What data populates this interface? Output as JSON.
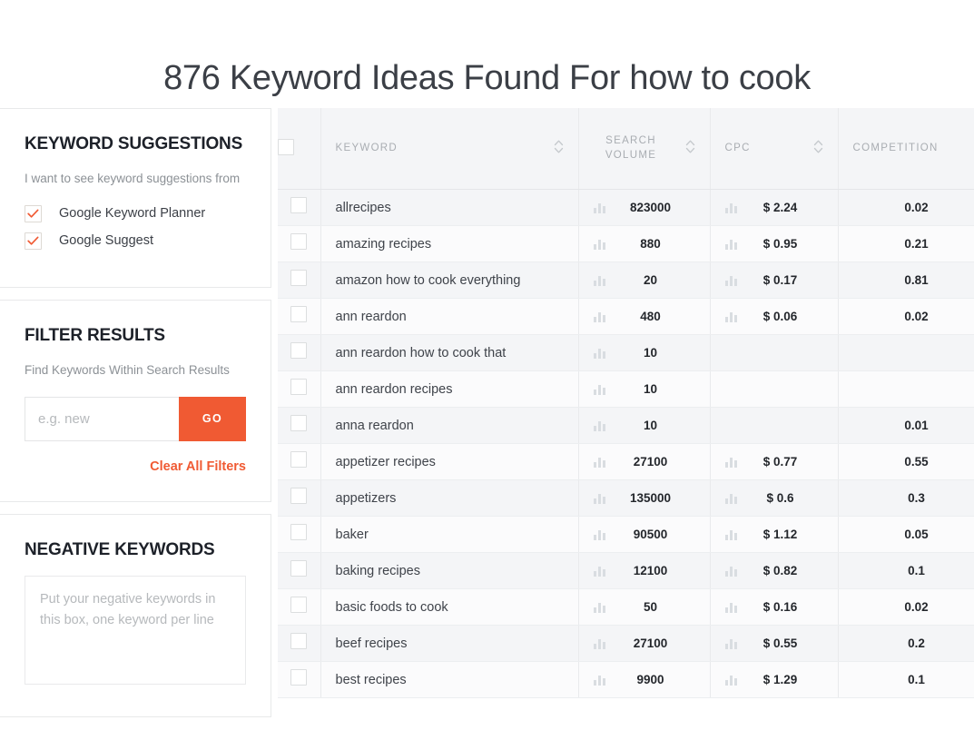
{
  "page": {
    "title": "876 Keyword Ideas Found For how to cook"
  },
  "sidebar": {
    "keyword_suggestions": {
      "title": "KEYWORD SUGGESTIONS",
      "subtitle": "I want to see keyword suggestions from",
      "options": [
        {
          "label": "Google Keyword Planner",
          "checked": true
        },
        {
          "label": "Google Suggest",
          "checked": true
        }
      ]
    },
    "filter_results": {
      "title": "FILTER RESULTS",
      "subtitle": "Find Keywords Within Search Results",
      "input_value": "",
      "input_placeholder": "e.g. new",
      "go_label": "GO",
      "clear_label": "Clear All Filters"
    },
    "negative_keywords": {
      "title": "NEGATIVE KEYWORDS",
      "textarea_value": "",
      "textarea_placeholder": "Put your negative keywords in this box, one keyword per line"
    }
  },
  "table": {
    "columns": [
      {
        "key": "checkbox",
        "label": "",
        "sortable": false
      },
      {
        "key": "keyword",
        "label": "KEYWORD",
        "sortable": true
      },
      {
        "key": "search_volume",
        "label": "SEARCH VOLUME",
        "sortable": true
      },
      {
        "key": "cpc",
        "label": "CPC",
        "sortable": true
      },
      {
        "key": "competition",
        "label": "COMPETITION",
        "sortable": false
      }
    ],
    "rows": [
      {
        "keyword": "allrecipes",
        "search_volume": "823000",
        "cpc": "$ 2.24",
        "competition": "0.02"
      },
      {
        "keyword": "amazing recipes",
        "search_volume": "880",
        "cpc": "$ 0.95",
        "competition": "0.21"
      },
      {
        "keyword": "amazon how to cook everything",
        "search_volume": "20",
        "cpc": "$ 0.17",
        "competition": "0.81"
      },
      {
        "keyword": "ann reardon",
        "search_volume": "480",
        "cpc": "$ 0.06",
        "competition": "0.02"
      },
      {
        "keyword": "ann reardon how to cook that",
        "search_volume": "10",
        "cpc": "",
        "competition": ""
      },
      {
        "keyword": "ann reardon recipes",
        "search_volume": "10",
        "cpc": "",
        "competition": ""
      },
      {
        "keyword": "anna reardon",
        "search_volume": "10",
        "cpc": "",
        "competition": "0.01"
      },
      {
        "keyword": "appetizer recipes",
        "search_volume": "27100",
        "cpc": "$ 0.77",
        "competition": "0.55"
      },
      {
        "keyword": "appetizers",
        "search_volume": "135000",
        "cpc": "$ 0.6",
        "competition": "0.3"
      },
      {
        "keyword": "baker",
        "search_volume": "90500",
        "cpc": "$ 1.12",
        "competition": "0.05"
      },
      {
        "keyword": "baking recipes",
        "search_volume": "12100",
        "cpc": "$ 0.82",
        "competition": "0.1"
      },
      {
        "keyword": "basic foods to cook",
        "search_volume": "50",
        "cpc": "$ 0.16",
        "competition": "0.02"
      },
      {
        "keyword": "beef recipes",
        "search_volume": "27100",
        "cpc": "$ 0.55",
        "competition": "0.2"
      },
      {
        "keyword": "best recipes",
        "search_volume": "9900",
        "cpc": "$ 1.29",
        "competition": "0.1"
      }
    ]
  },
  "icons": {
    "checkmark": "check-icon",
    "sort": "sort-updown-icon",
    "bar": "bar-chart-icon"
  },
  "colors": {
    "accent": "#f05a33",
    "text": "#3f434a",
    "muted": "#a9adb2",
    "row_odd": "#f4f5f7",
    "row_even": "#fbfbfc"
  }
}
